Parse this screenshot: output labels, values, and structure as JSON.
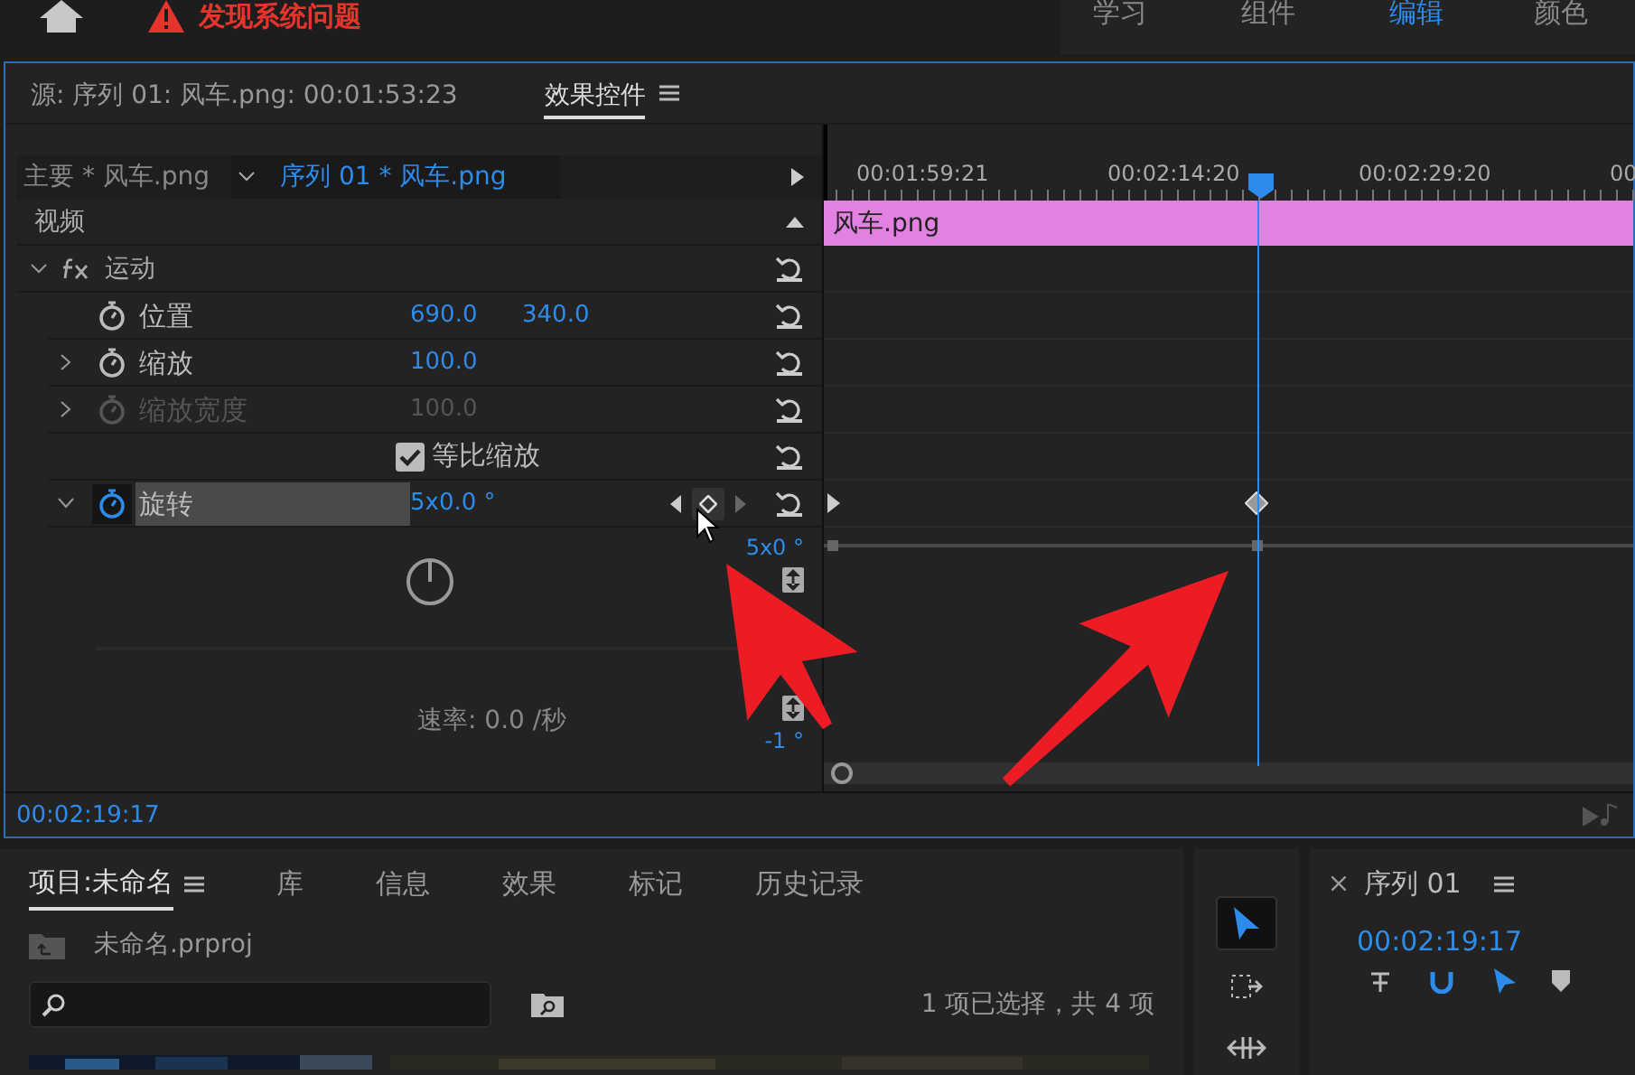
{
  "top_bar": {
    "warning": "发现系统问题",
    "workspaces": [
      {
        "label": "学习",
        "selected": false
      },
      {
        "label": "组件",
        "selected": false
      },
      {
        "label": "编辑",
        "selected": true
      },
      {
        "label": "颜色",
        "selected": false
      }
    ]
  },
  "effect_panel": {
    "tabs": [
      {
        "label": "源: 序列 01: 风车.png: 00:01:53:23",
        "selected": false
      },
      {
        "label": "效果控件",
        "selected": true
      }
    ],
    "clip_tabs": [
      {
        "label": "主要 * 风车.png",
        "selected": false
      },
      {
        "label": "序列 01 * 风车.png",
        "selected": true
      }
    ],
    "section": "视频",
    "effect": {
      "name": "运动",
      "expanded": true
    },
    "properties": [
      {
        "kind": "value",
        "name": "位置",
        "values": [
          "690.0",
          "340.0"
        ],
        "expandable": false,
        "disabled": false,
        "animating": false
      },
      {
        "kind": "value",
        "name": "缩放",
        "values": [
          "100.0"
        ],
        "expandable": true,
        "disabled": false,
        "animating": false
      },
      {
        "kind": "value",
        "name": "缩放宽度",
        "values": [
          "100.0"
        ],
        "expandable": true,
        "disabled": true,
        "animating": false
      },
      {
        "kind": "checkbox",
        "name": "等比缩放",
        "checked": true
      },
      {
        "kind": "value",
        "name": "旋转",
        "values": [
          "5x0.0 °"
        ],
        "expandable": true,
        "expanded": true,
        "disabled": false,
        "animating": true,
        "highlighted": true
      }
    ],
    "rotation_graph": {
      "max": "5x0 °",
      "min": "-1 °",
      "speed": "速率: 0.0 /秒"
    },
    "timecode": "00:02:19:17"
  },
  "timeline": {
    "ticks": [
      "00:01:59:21",
      "00:02:14:20",
      "00:02:29:20",
      "00"
    ],
    "clip": "风车.png"
  },
  "project_panel": {
    "tabs": [
      {
        "label": "项目:未命名",
        "selected": true
      },
      {
        "label": "库",
        "selected": false
      },
      {
        "label": "信息",
        "selected": false
      },
      {
        "label": "效果",
        "selected": false
      },
      {
        "label": "标记",
        "selected": false
      },
      {
        "label": "历史记录",
        "selected": false
      }
    ],
    "file": "未命名.prproj",
    "status": "1 项已选择，共 4 项"
  },
  "tools": [
    {
      "kind": "selection",
      "selected": true
    },
    {
      "kind": "marquee",
      "selected": false
    },
    {
      "kind": "move",
      "selected": false
    }
  ],
  "sequence_panel": {
    "title": "序列 01",
    "timecode": "00:02:19:17"
  }
}
